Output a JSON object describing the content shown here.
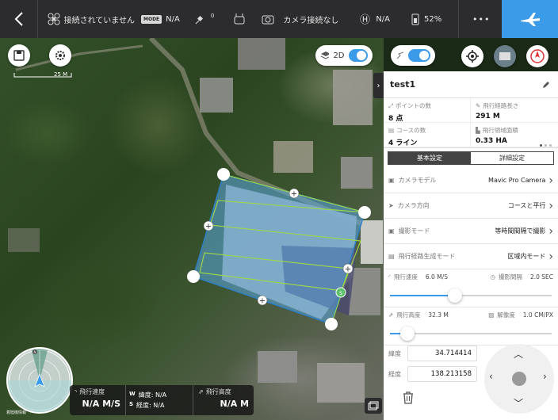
{
  "topbar": {
    "connection_status": "接続されていません",
    "mode_badge": "MODE",
    "mode_value": "N/A",
    "satellite_count": "0",
    "camera_status": "カメラ接続なし",
    "signal_value": "N/A",
    "battery_percent": "52%",
    "more_label": "•••"
  },
  "map_controls": {
    "view_mode_label": "2D",
    "scale_label": "25 M"
  },
  "mission": {
    "name": "test1",
    "stats": [
      {
        "label": "ポイントの数",
        "value": "8 点",
        "icon": "waypoint-icon"
      },
      {
        "label": "飛行経路長さ",
        "value": "291 M",
        "icon": "path-length-icon"
      },
      {
        "label": "コースの数",
        "value": "4 ライン",
        "icon": "course-icon"
      },
      {
        "label": "飛行領域面積",
        "value": "0.33 HA",
        "icon": "area-icon"
      }
    ],
    "tabs": [
      {
        "label": "基本設定",
        "active": true
      },
      {
        "label": "詳細設定",
        "active": false
      }
    ],
    "settings": [
      {
        "label": "カメラモデル",
        "value": "Mavic Pro Camera",
        "icon": "camera-icon"
      },
      {
        "label": "カメラ方向",
        "value": "コースと平行",
        "icon": "direction-icon"
      },
      {
        "label": "撮影モード",
        "value": "等時間間隔で撮影",
        "icon": "shoot-mode-icon"
      },
      {
        "label": "飛行経路生成モード",
        "value": "区域内モード",
        "icon": "route-mode-icon"
      }
    ],
    "flight_speed": {
      "label": "飛行速度",
      "value": "6.0 M/S",
      "fraction": 0.4
    },
    "shooting_interval": {
      "label": "撮影間隔",
      "value": "2.0 SEC"
    },
    "flight_altitude": {
      "label": "飛行高度",
      "value": "32.3 M",
      "fraction": 0.11
    },
    "resolution": {
      "label": "解像度",
      "value": "1.0 CM/PX"
    },
    "latitude": {
      "label": "緯度",
      "value": "34.714414"
    },
    "longitude": {
      "label": "経度",
      "value": "138.213158"
    }
  },
  "telemetry": {
    "speed_label": "飛行速度",
    "speed_value": "N/A M/S",
    "w_key": "W",
    "lat_label": "緯度: N/A",
    "s_key": "S",
    "lon_label": "経度: N/A",
    "altitude_label": "飛行高度",
    "altitude_value": "N/A M",
    "radar_caption": "着陸機情報"
  },
  "colors": {
    "accent": "#3c9be8",
    "area_fill": "#5aa8e0",
    "path_line": "#9ed84a"
  }
}
